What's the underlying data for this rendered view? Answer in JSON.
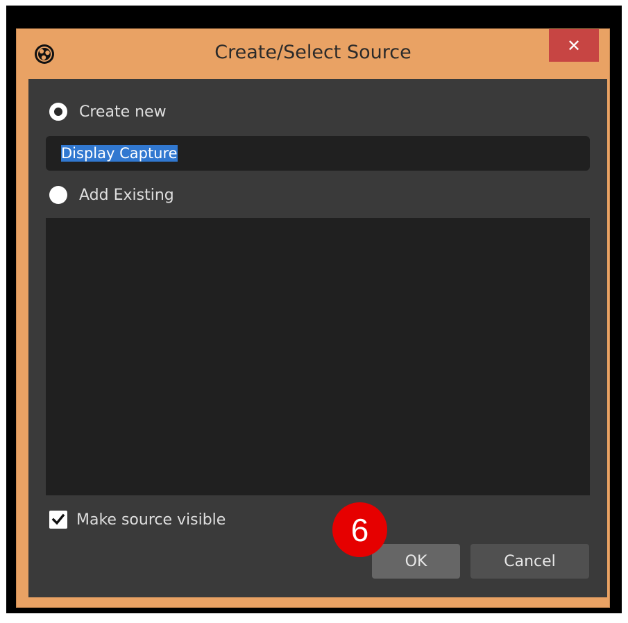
{
  "window": {
    "title": "Create/Select Source",
    "close_label": "✕",
    "colors": {
      "frame": "#e9a264",
      "client": "#3a3a3a",
      "close": "#c74543"
    }
  },
  "options": {
    "create_new_label": "Create new",
    "create_new_selected": true,
    "name_value": "Display Capture",
    "add_existing_label": "Add Existing",
    "add_existing_selected": false,
    "existing_sources": []
  },
  "visibility": {
    "label": "Make source visible",
    "checked": true
  },
  "buttons": {
    "ok_label": "OK",
    "cancel_label": "Cancel"
  },
  "annotation": {
    "step_number": "6",
    "color": "#e60000"
  },
  "icons": {
    "app": "obs-logo-icon",
    "close": "close-icon",
    "check": "checkmark-icon"
  }
}
